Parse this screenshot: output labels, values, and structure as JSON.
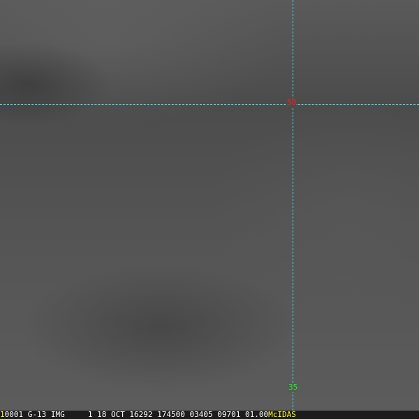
{
  "image": {
    "type": "satellite-imagery",
    "crosshair_color": "#3fe3ef"
  },
  "labels": {
    "latitude": "50",
    "longitude": "35",
    "latitude_color": "#ff1a1a",
    "longitude_color": "#22ee22"
  },
  "status_bar": {
    "frame_number": "1",
    "info": "0001 G-13 IMG     1 18 OCT 16292 174500 03405 09701 01.00",
    "brand": "McIDAS"
  }
}
